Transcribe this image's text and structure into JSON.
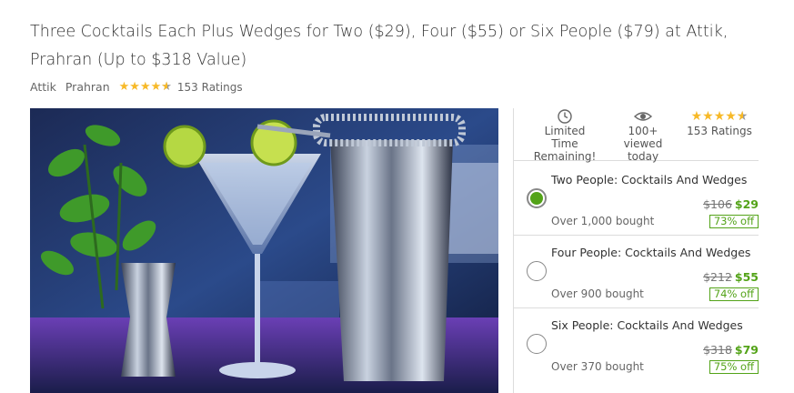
{
  "deal": {
    "title": "Three Cocktails Each Plus Wedges for Two ($29), Four ($55) or Six People ($79) at Attik, Prahran (Up to $318 Value)",
    "merchant": "Attik",
    "location": "Prahran",
    "rating_stars": 4.5,
    "ratings_count": "153 Ratings"
  },
  "stats": {
    "time_label_1": "Limited Time",
    "time_label_2": "Remaining!",
    "viewed_label_1": "100+ viewed",
    "viewed_label_2": "today",
    "ratings": "153 Ratings"
  },
  "options": [
    {
      "name": "Two People: Cocktails And Wedges",
      "old_price": "$106",
      "new_price": "$29",
      "discount": "73% off",
      "bought": "Over 1,000 bought",
      "selected": true
    },
    {
      "name": "Four People: Cocktails And Wedges",
      "old_price": "$212",
      "new_price": "$55",
      "discount": "74% off",
      "bought": "Over 900 bought",
      "selected": false
    },
    {
      "name": "Six People: Cocktails And Wedges",
      "old_price": "$318",
      "new_price": "$79",
      "discount": "75% off",
      "bought": "Over 370 bought",
      "selected": false
    }
  ],
  "icons": {
    "clock": "clock-icon",
    "eye": "eye-icon",
    "star": "star-icon"
  },
  "colors": {
    "accent_green": "#53a318",
    "star_gold": "#f7b928"
  }
}
